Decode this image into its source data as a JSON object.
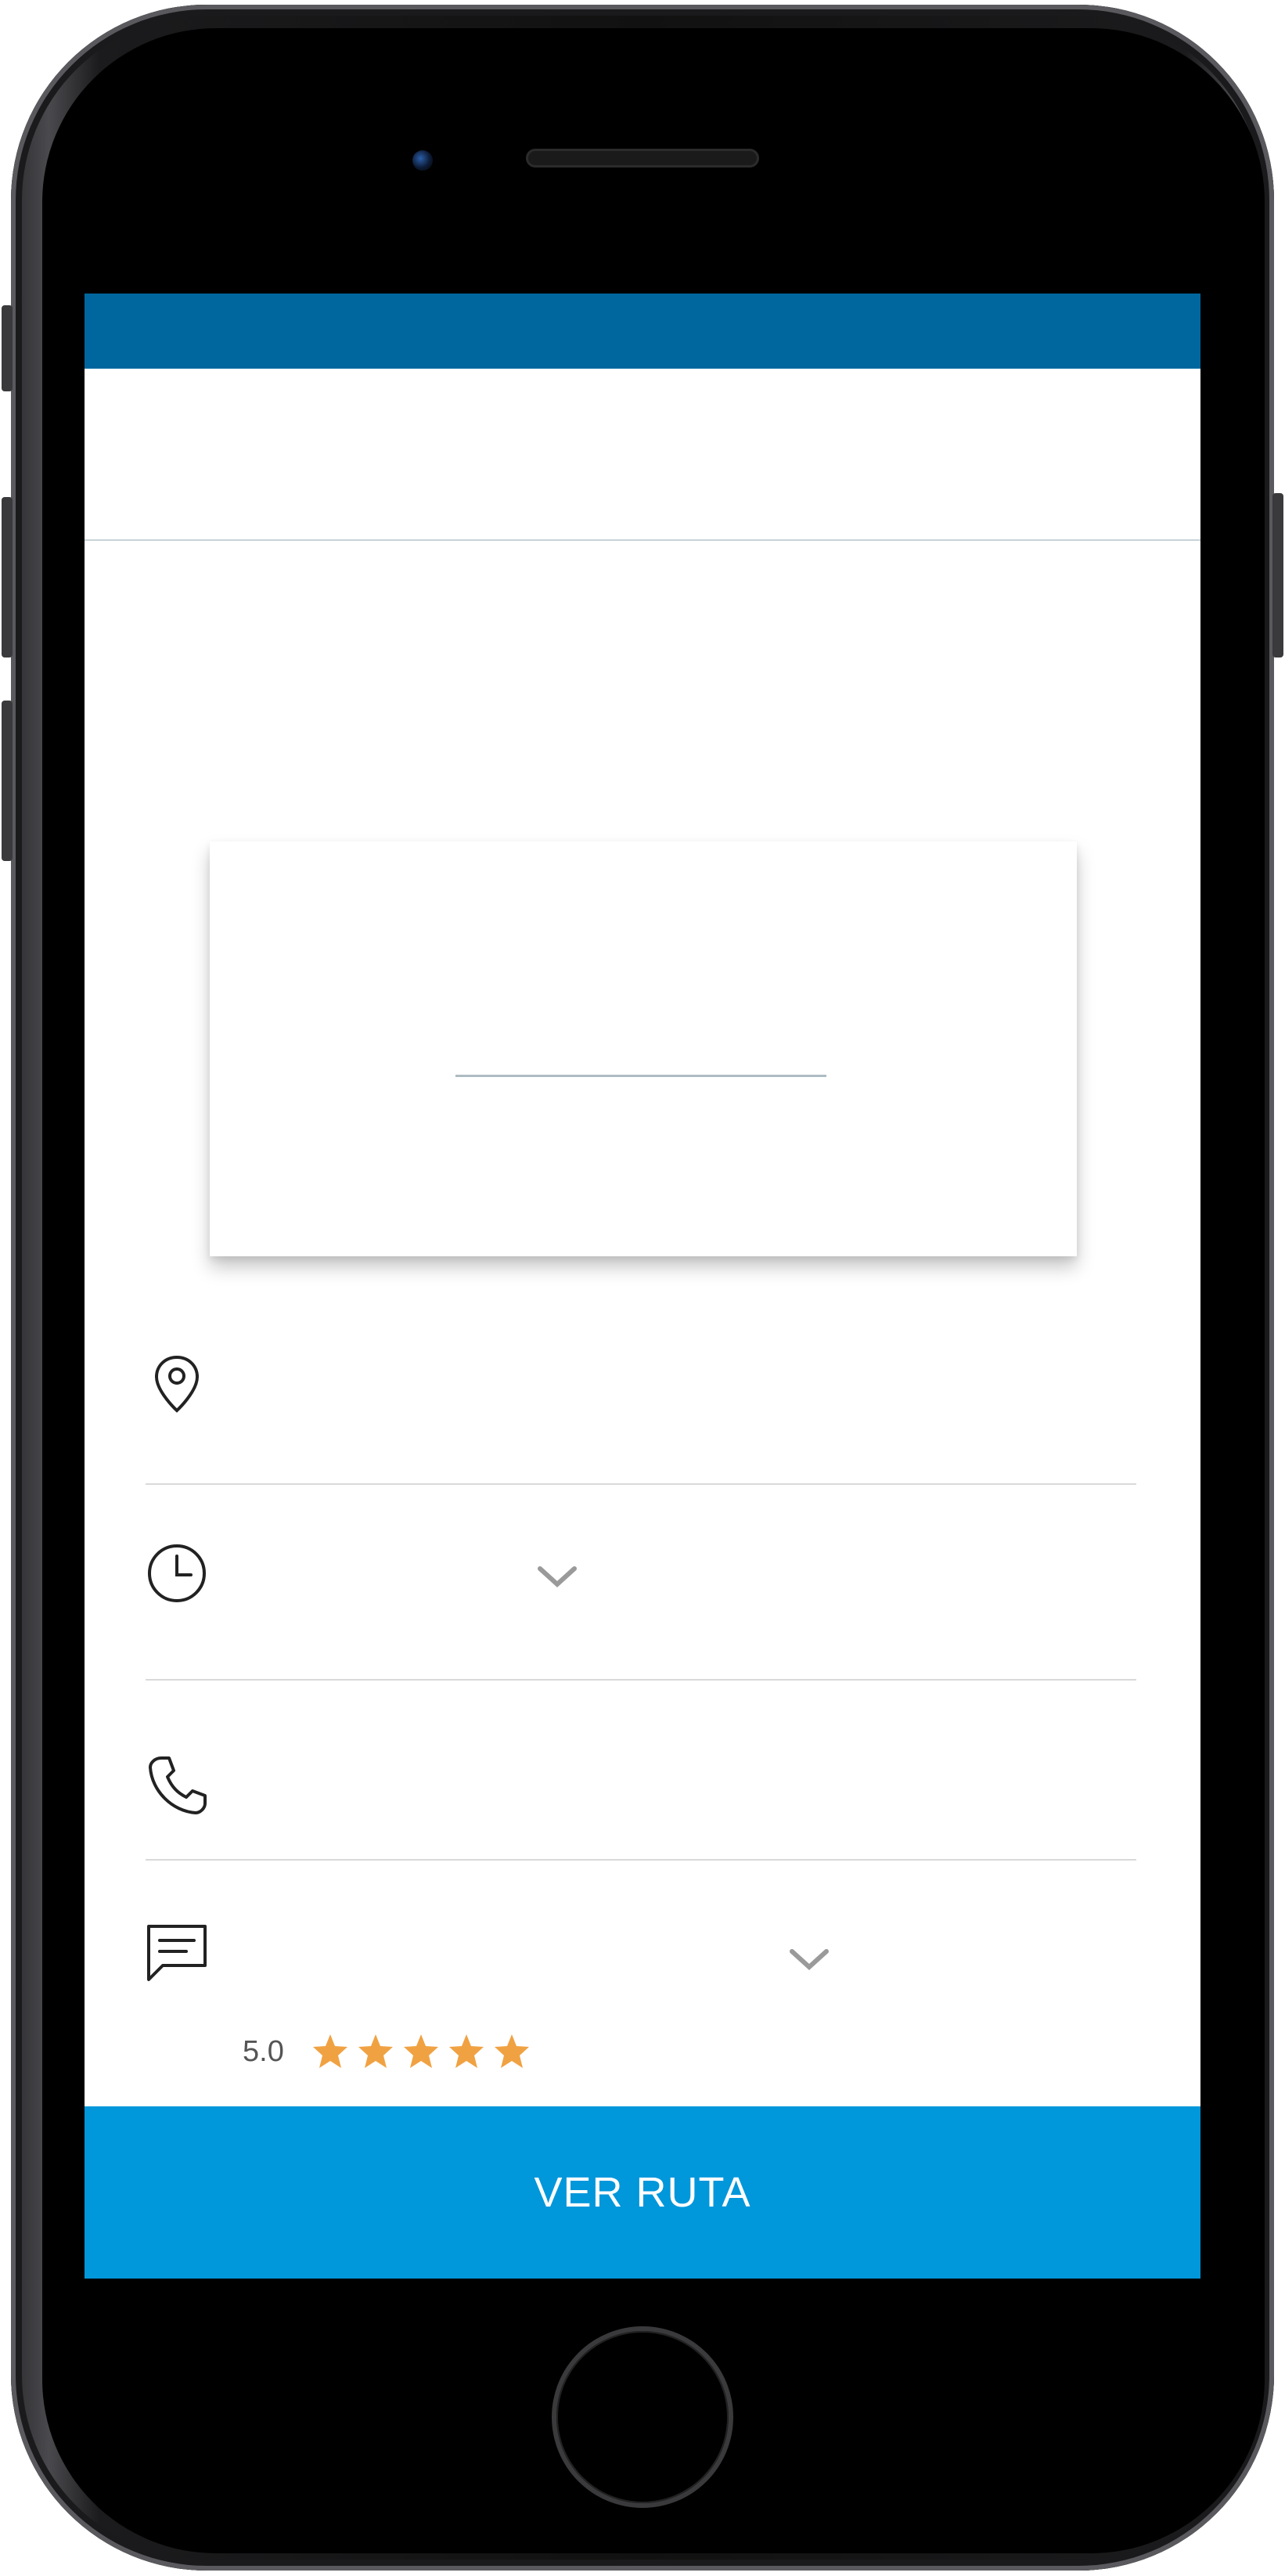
{
  "colors": {
    "status_bar": "#00679e",
    "primary_button": "#0097db",
    "star": "#f0a243",
    "rating_text": "#555555"
  },
  "details": {
    "location_icon": "location-pin-icon",
    "hours_icon": "clock-icon",
    "phone_icon": "phone-icon",
    "reviews_icon": "chat-bubble-icon",
    "expand_icon": "chevron-down-icon"
  },
  "rating": {
    "value": "5.0",
    "stars": 5
  },
  "footer": {
    "route_button_label": "VER RUTA"
  }
}
